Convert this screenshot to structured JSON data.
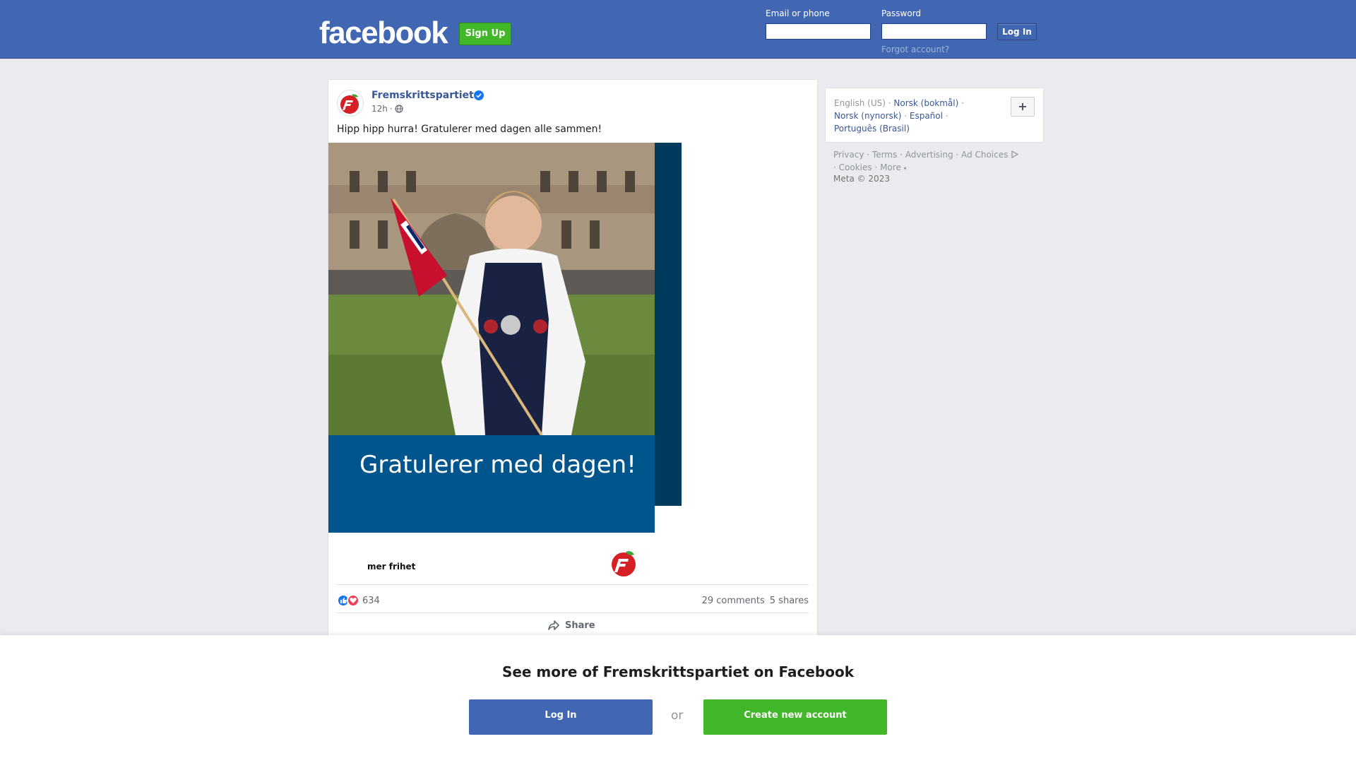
{
  "topbar": {
    "logo_text": "facebook",
    "signup_label": "Sign Up",
    "email_label": "Email or phone",
    "email_value": "",
    "password_label": "Password",
    "password_value": "",
    "login_label": "Log In",
    "forgot_label": "Forgot account?",
    "bg_color": "#4267b2"
  },
  "post": {
    "page_name": "Fremskrittspartiet",
    "verified": true,
    "time": "12h",
    "audience_icon": "globe-icon",
    "text": "Hipp hipp hurra! Gratulerer med dagen alle sammen!",
    "image": {
      "headline": "Gratulerer med dagen!",
      "slogan": "mer frihet",
      "logo_icon": "apple-logo-icon"
    },
    "reactions": {
      "icons": [
        "like-icon",
        "love-icon"
      ],
      "count": "634",
      "comments": "29 comments",
      "shares": "5 shares"
    },
    "share_label": "Share"
  },
  "sidebar": {
    "languages": {
      "current": "English (US)",
      "links": [
        "Norsk (bokmål)",
        "Norsk (nynorsk)",
        "Español",
        "Português (Brasil)"
      ],
      "more_label": "+"
    },
    "footer": {
      "links": [
        "Privacy",
        "Terms",
        "Advertising",
        "Ad Choices",
        "Cookies",
        "More"
      ],
      "copyright": "Meta © 2023"
    }
  },
  "overlay": {
    "title": "See more of Fremskrittspartiet on Facebook",
    "login_label": "Log In",
    "or_label": "or",
    "create_label": "Create new account"
  }
}
